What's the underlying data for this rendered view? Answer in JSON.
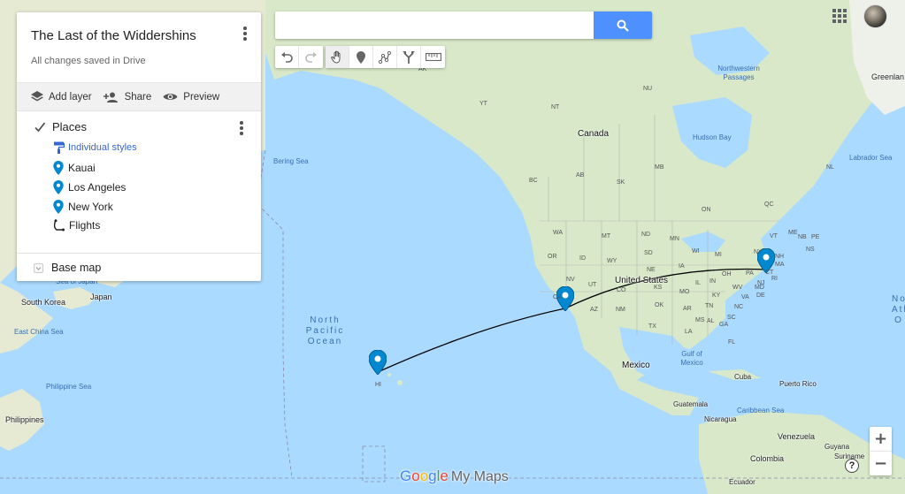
{
  "map_title": "The Last of the Widdershins",
  "save_status": "All changes saved in Drive",
  "actions": {
    "add_layer": "Add layer",
    "share": "Share",
    "preview": "Preview"
  },
  "layer": {
    "name": "Places",
    "style_label": "Individual styles",
    "items": [
      {
        "label": "Kauai",
        "icon": "place-marker-icon"
      },
      {
        "label": "Los Angeles",
        "icon": "place-marker-icon"
      },
      {
        "label": "New York",
        "icon": "place-marker-icon"
      },
      {
        "label": "Flights",
        "icon": "line-path-icon"
      }
    ]
  },
  "base_map_label": "Base map",
  "search": {
    "value": "",
    "placeholder": ""
  },
  "zoom": {
    "in": "+",
    "out": "−"
  },
  "help": "?",
  "logo": {
    "google": "Google",
    "product": "My Maps"
  },
  "colors": {
    "marker": "#0288d1",
    "accent": "#4d90fe",
    "link": "#3367d6",
    "route": "#000000"
  },
  "map_labels": {
    "countries": [
      "Canada",
      "United States",
      "Mexico",
      "South Korea",
      "Japan",
      "Philippines",
      "Cuba",
      "Guatemala",
      "Nicaragua",
      "Venezuela",
      "Colombia",
      "Ecuador",
      "Guyana",
      "Suriname",
      "Puerto Rico",
      "Greenlan"
    ],
    "water": [
      "Bering Sea",
      "Hudson Bay",
      "Labrador Sea",
      "Northwestern Passages",
      "East China Sea",
      "Philippine Sea",
      "Gulf of Mexico",
      "Caribbean Sea",
      "Sea of Japan"
    ],
    "ocean": "North Pacific Ocean",
    "ocean_partial": "North Atl O",
    "regions": [
      "AK",
      "YT",
      "NT",
      "NU",
      "BC",
      "AB",
      "SK",
      "MB",
      "ON",
      "QC",
      "NL",
      "WA",
      "OR",
      "ID",
      "MT",
      "ND",
      "MN",
      "WI",
      "MI",
      "NY",
      "VT",
      "ME",
      "NH",
      "NB",
      "NS",
      "PE",
      "SD",
      "WY",
      "NV",
      "CA",
      "UT",
      "CO",
      "NE",
      "KS",
      "IA",
      "IL",
      "IN",
      "OH",
      "PA",
      "NJ",
      "DE",
      "MA",
      "CT",
      "RI",
      "MD",
      "WV",
      "VA",
      "KY",
      "MO",
      "TN",
      "NC",
      "SC",
      "AZ",
      "NM",
      "OK",
      "AR",
      "MS",
      "AL",
      "GA",
      "TX",
      "LA",
      "FL",
      "HI"
    ]
  }
}
